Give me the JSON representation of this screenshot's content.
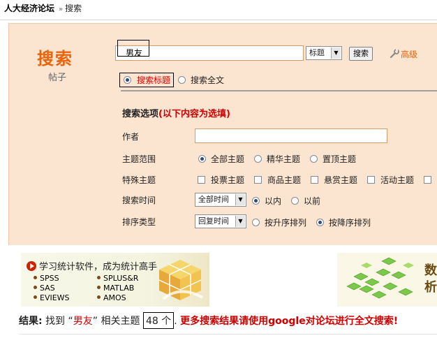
{
  "breadcrumb": {
    "site": "人大经济论坛",
    "separator": "»",
    "current": "搜索"
  },
  "page": {
    "title": "搜索",
    "subtitle": "帖子"
  },
  "search": {
    "keyword": "男友",
    "field_select": "标题",
    "search_button": "搜索",
    "advanced_link": "高级",
    "scope_title_label": "搜索标题",
    "scope_full_label": "搜索全文",
    "selected_scope": "搜索标题"
  },
  "options": {
    "heading": "搜索选项",
    "heading_note": "(以下内容为选填)",
    "author_label": "作者",
    "author_value": "",
    "topic_range_label": "主题范围",
    "topic_range": [
      {
        "label": "全部主题",
        "checked": true
      },
      {
        "label": "精华主题",
        "checked": false
      },
      {
        "label": "置顶主题",
        "checked": false
      }
    ],
    "special_label": "特殊主题",
    "special": [
      {
        "label": "投票主题",
        "checked": false
      },
      {
        "label": "商品主题",
        "checked": false
      },
      {
        "label": "悬赏主题",
        "checked": false
      },
      {
        "label": "活动主题",
        "checked": false
      }
    ],
    "time_label": "搜索时间",
    "time_select": "全部时间",
    "time_range": [
      {
        "label": "以内",
        "checked": true
      },
      {
        "label": "以前",
        "checked": false
      }
    ],
    "sort_label": "排序类型",
    "sort_select": "回复时间",
    "sort_order": [
      {
        "label": "按升序排列",
        "checked": false
      },
      {
        "label": "按降序排列",
        "checked": true
      }
    ]
  },
  "ad_left": {
    "title": "学习统计软件，成为统计高手",
    "col1": [
      "SPSS",
      "SAS",
      "EVIEWS"
    ],
    "col2": [
      "SPLUS&R",
      "MATLAB",
      "AMOS"
    ]
  },
  "ad_right": {
    "line1": "数",
    "line2": "析"
  },
  "results": {
    "label": "结果:",
    "found": "找到",
    "open_quote": "“",
    "keyword": "男友",
    "close_quote": "”",
    "related": "相关主题",
    "count": "48 个",
    "comma": ".",
    "more": "更多搜索结果请使用google对论坛进行全文搜索!"
  },
  "colors": {
    "accent": "#e8650e",
    "panel_bg": "#fbe4d0",
    "highlight": "#cc0000"
  }
}
